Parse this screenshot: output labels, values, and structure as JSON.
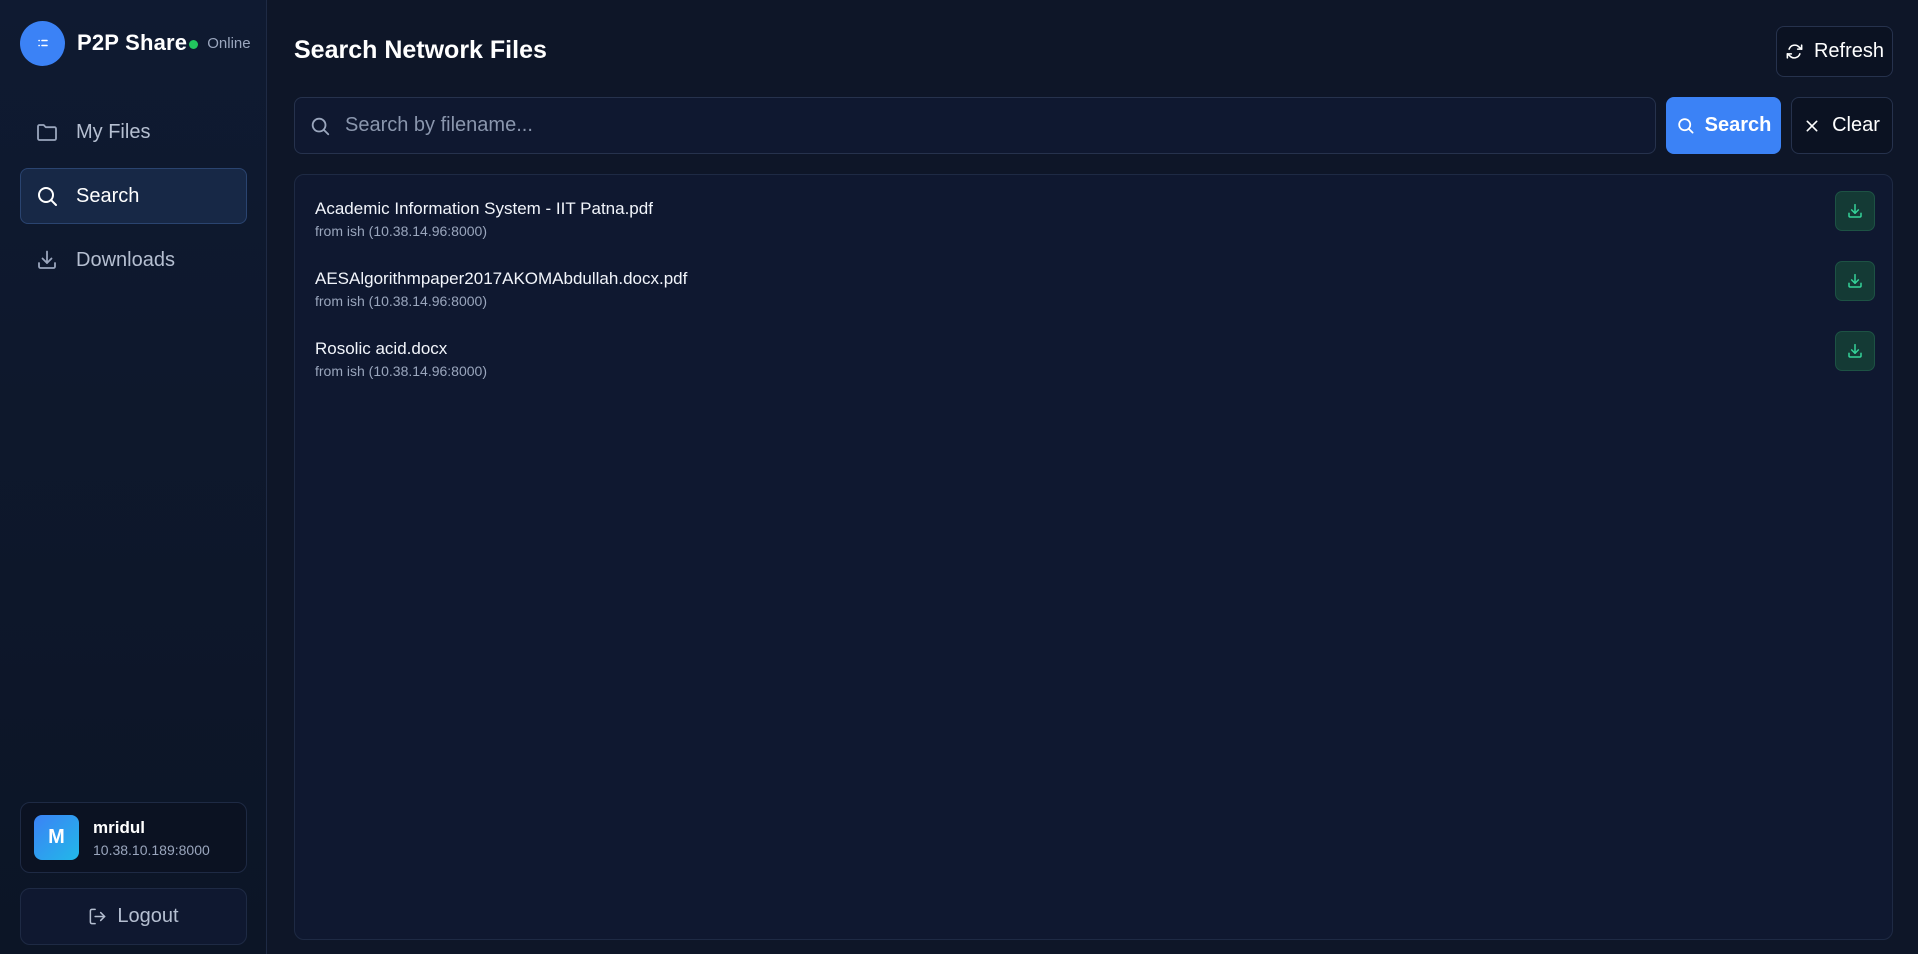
{
  "app": {
    "brand_title": "P2P Share",
    "status_label": "Online",
    "status_color": "#22c55e",
    "accent_color": "#3b82f6"
  },
  "sidebar": {
    "items": [
      {
        "label": "My Files",
        "icon": "folder-icon",
        "active": false
      },
      {
        "label": "Search",
        "icon": "search-icon",
        "active": true
      },
      {
        "label": "Downloads",
        "icon": "download-icon",
        "active": false
      }
    ],
    "user": {
      "initial": "M",
      "name": "mridul",
      "address": "10.38.10.189:8000"
    },
    "logout_label": "Logout"
  },
  "main": {
    "title": "Search Network Files",
    "refresh_label": "Refresh",
    "search": {
      "placeholder": "Search by filename...",
      "value": "",
      "search_label": "Search",
      "clear_label": "Clear"
    },
    "results": [
      {
        "name": "Academic Information System - IIT Patna.pdf",
        "source": "from ish (10.38.14.96:8000)"
      },
      {
        "name": "AESAlgorithmpaper2017AKOMAbdullah.docx.pdf",
        "source": "from ish (10.38.14.96:8000)"
      },
      {
        "name": "Rosolic acid.docx",
        "source": "from ish (10.38.14.96:8000)"
      }
    ]
  }
}
